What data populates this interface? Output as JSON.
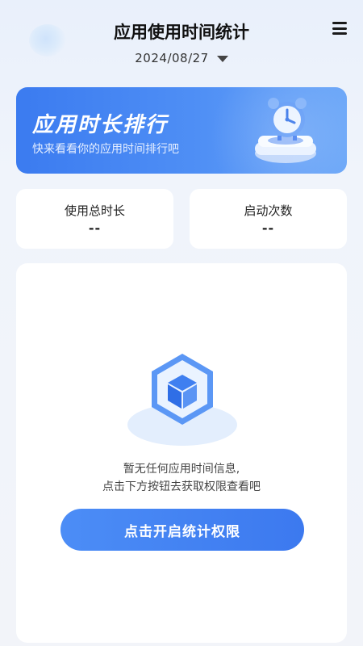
{
  "header": {
    "title": "应用使用时间统计",
    "date": "2024/08/27"
  },
  "banner": {
    "title": "应用时长排行",
    "subtitle": "快来看看你的应用时间排行吧"
  },
  "stats": [
    {
      "label": "使用总时长",
      "value": "--"
    },
    {
      "label": "启动次数",
      "value": "--"
    }
  ],
  "empty_state": {
    "line1": "暂无任何应用时间信息,",
    "line2": "点击下方按钮去获取权限查看吧",
    "button_label": "点击开启统计权限"
  },
  "colors": {
    "accent": "#3b7bf0",
    "background": "#f0f4fb"
  }
}
